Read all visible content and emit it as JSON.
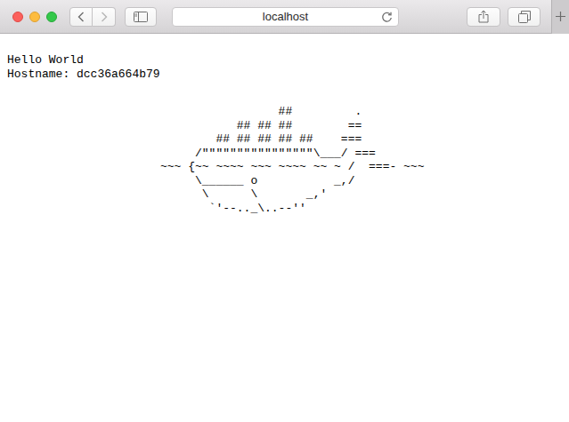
{
  "browser": {
    "address": "localhost"
  },
  "page": {
    "lines": [
      "Hello World",
      "Hostname: dcc36a664b79"
    ],
    "art": [
      "                 ##         .",
      "           ## ## ##        ==",
      "        ## ## ## ## ##    ===",
      "     /\"\"\"\"\"\"\"\"\"\"\"\"\"\"\"\"\\___/ ===",
      "~~~ {~~ ~~~~ ~~~ ~~~~ ~~ ~ /  ===- ~~~",
      "     \\______ o           _,/",
      "      \\      \\       _,'",
      "       `'--.._\\..--''"
    ]
  }
}
